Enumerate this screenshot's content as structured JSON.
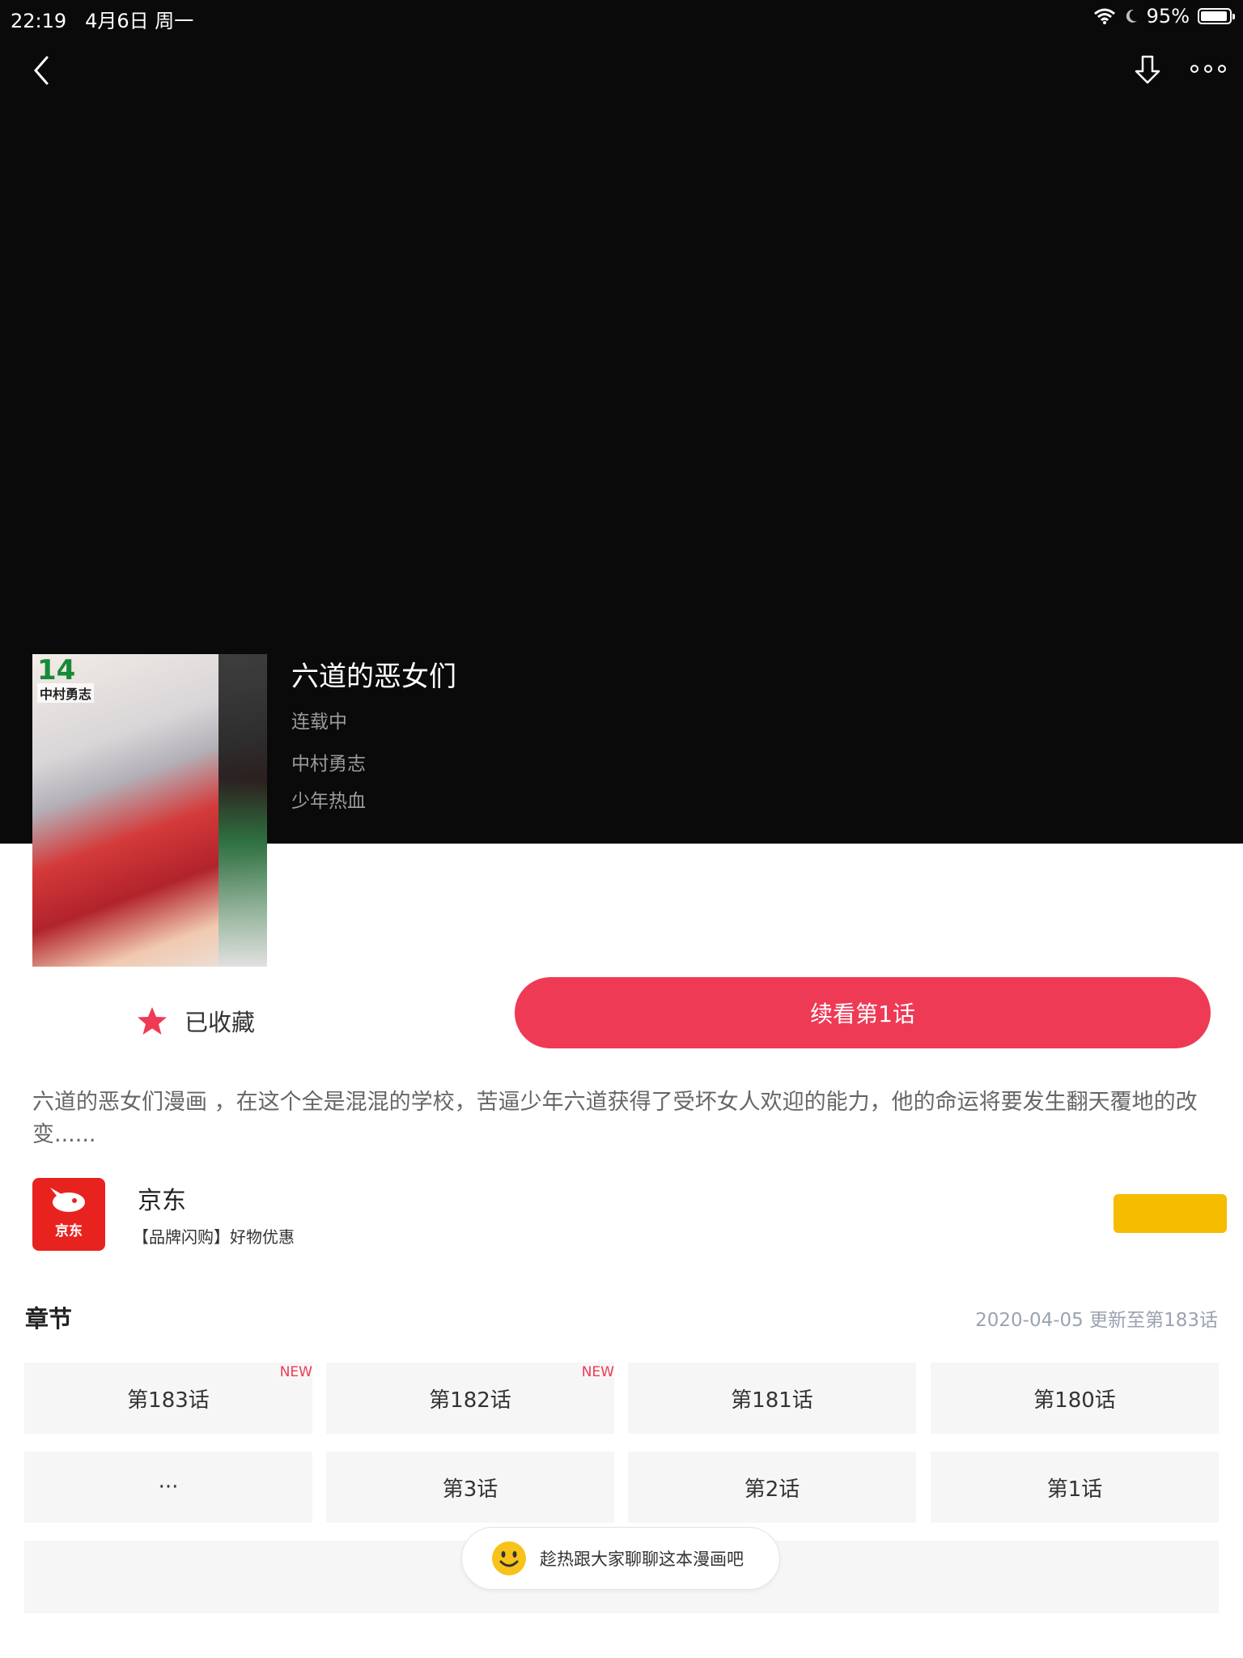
{
  "status_bar": {
    "time": "22:19",
    "date": "4月6日 周一",
    "battery": "95%",
    "battery_level": 0.95
  },
  "nav": {
    "back_icon": "chevron-left-icon",
    "download_icon": "download-icon",
    "more_icon": "more-icon"
  },
  "comic": {
    "title": "六道的恶女们",
    "status": "连载中",
    "author": "中村勇志",
    "genre": "少年热血",
    "cover_volume": "14",
    "cover_author": "中村勇志"
  },
  "actions": {
    "favorite_label": "已收藏",
    "continue_label": "续看第1话"
  },
  "description": "六道的恶女们漫画 ，在这个全是混混的学校，苦逼少年六道获得了受坏女人欢迎的能力，他的命运将要发生翻天覆地的改变......",
  "ad": {
    "logo_text": "京东",
    "name": "京东",
    "desc": "【品牌闪购】好物优惠"
  },
  "chapters": {
    "title": "章节",
    "update": "2020-04-05 更新至第183话",
    "row1": [
      "第183话",
      "第182话",
      "第181话",
      "第180话"
    ],
    "row2": [
      "···",
      "第3话",
      "第2话",
      "第1话"
    ],
    "new_label": "NEW"
  },
  "chat": {
    "label": "趁热跟大家聊聊这本漫画吧"
  },
  "colors": {
    "accent": "#ee3a55",
    "ad_button": "#f5bc00",
    "jd_red": "#e8231f"
  }
}
